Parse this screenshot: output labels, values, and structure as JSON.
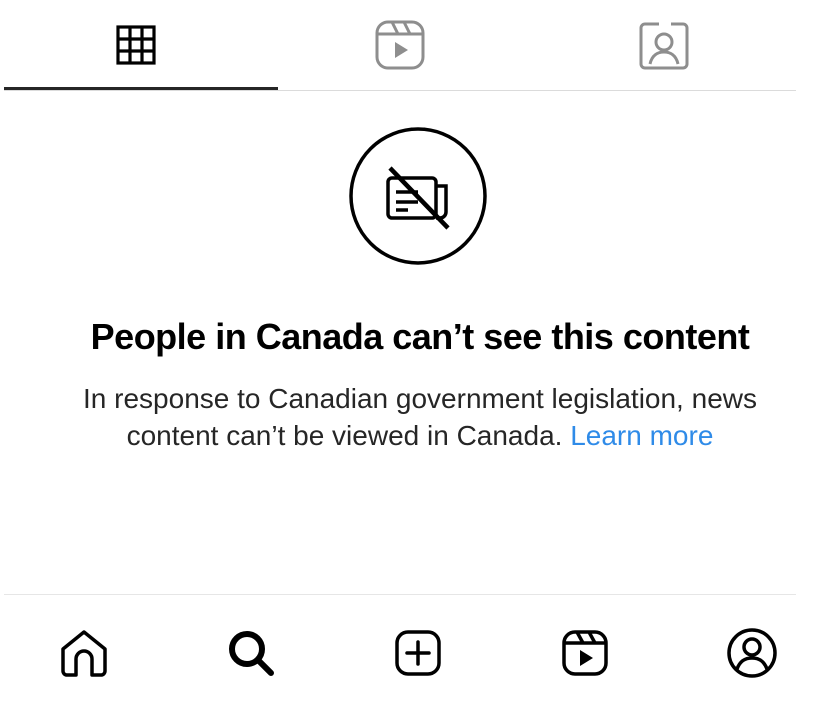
{
  "profile_tabs": [
    {
      "name": "posts-grid",
      "icon": "grid-icon",
      "selected": true
    },
    {
      "name": "reels",
      "icon": "reels-icon",
      "selected": false
    },
    {
      "name": "tagged",
      "icon": "tagged-person-icon",
      "selected": false
    }
  ],
  "notice": {
    "icon": "news-unavailable-icon",
    "title": "People in Canada can’t see this content",
    "body": "In response to Canadian government legislation, news content can’t be viewed in Canada.",
    "link_label": "Learn more"
  },
  "bottom_nav": [
    {
      "name": "home",
      "icon": "home-icon"
    },
    {
      "name": "search",
      "icon": "search-icon"
    },
    {
      "name": "create",
      "icon": "create-plus-icon"
    },
    {
      "name": "reels",
      "icon": "reels-icon"
    },
    {
      "name": "profile",
      "icon": "profile-avatar-icon"
    }
  ],
  "colors": {
    "link": "#2f8be8",
    "text": "#000000",
    "divider": "#dbdbdb",
    "active_indicator": "#262626"
  }
}
